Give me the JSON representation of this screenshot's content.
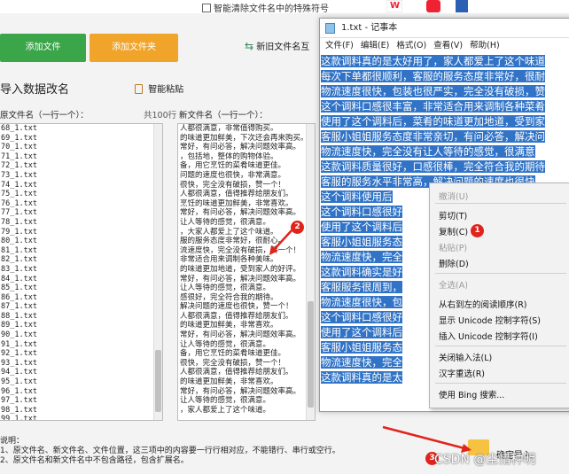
{
  "topbar": {
    "special_chars": "智能清除文件名中的特殊符号"
  },
  "toolbar": {
    "add_file": "添加文件",
    "add_folder": "添加文件夹",
    "new_old_label": "新旧文件名互"
  },
  "section": {
    "title": "导入数据改名",
    "paste_label": "智能粘贴"
  },
  "columns": {
    "original_header": "原文件名（一行一个）：",
    "count": "共100行",
    "new_header": "新文件名（一行一个）："
  },
  "original_files": [
    "68_1.txt",
    "69_1.txt",
    "70_1.txt",
    "71_1.txt",
    "72_1.txt",
    "73_1.txt",
    "74_1.txt",
    "75_1.txt",
    "76_1.txt",
    "77_1.txt",
    "78_1.txt",
    "79_1.txt",
    "80_1.txt",
    "81_1.txt",
    "82_1.txt",
    "83_1.txt",
    "84_1.txt",
    "85_1.txt",
    "86_1.txt",
    "87_1.txt",
    "88_1.txt",
    "89_1.txt",
    "90_1.txt",
    "91_1.txt",
    "92_1.txt",
    "93_1.txt",
    "94_1.txt",
    "95_1.txt",
    "96_1.txt",
    "97_1.txt",
    "98_1.txt",
    "99_1.txt"
  ],
  "new_files": [
    "人都很满意，非常值得购买。",
    "的味道更加鲜美，下次还会再来购买。",
    "常好，有问必答，解决问题效率高。",
    "，包括地，整体的购物体验。",
    "备，用它烹饪的菜肴味道更佳。",
    "问题的速度也很快，非常满意。",
    "很快，完全没有破损，赞一个！",
    "人都很满意，值得推荐给朋友们。",
    "烹饪的味道更加鲜美，非常喜欢。",
    "常好，有问必答，解决问题效率高。",
    "让人等待的感觉，很满意。",
    "，大家人都爱上了这个味道。",
    "服的服务态度非常好，很耐心。",
    "流速度快，完全没有破损，赞一个！",
    "非常适合用来调制各种美味。",
    "的味道更加地道，受到家人的好评。",
    "常好，有问必答，解决问题效率高。",
    "让人等待的感觉，很满意。",
    "感很好，完全符合我的期待。",
    "解决问题的速度也很快，赞一个！",
    "人都很满意，值得推荐给朋友们。",
    "的味道更加鲜美，非常喜欢。",
    "常好，有问必答，解决问题效率高。",
    "让人等待的感觉，很满意。",
    "备，用它烹饪的菜肴味道更佳。",
    "很快，完全没有破损，赞一个！",
    "人都很满意，值得推荐给朋友们。",
    "的味道更加鲜美，非常喜欢。",
    "常好，有问必答，解决问题效率高。",
    "让人等待的感觉，很满意。",
    "，家人都爱上了这个味道。"
  ],
  "notepad": {
    "title": "1.txt - 记事本",
    "menus": [
      "文件(F)",
      "编辑(E)",
      "格式(O)",
      "查看(V)",
      "帮助(H)"
    ],
    "lines": [
      "这款调料真的是太好用了，家人都爱上了这个味道",
      "每次下单都很顺利，客服的服务态度非常好，很耐",
      "物流速度很快，包装也很严实，完全没有破损，赞",
      "这个调料口感很丰富，非常适合用来调制各种菜肴",
      "使用了这个调料后，菜肴的味道更加地道，受到家",
      "客服小姐姐服务态度非常亲切，有问必答，解决问",
      "物流速度快，完全没有让人等待的感觉，很满意",
      "这款调料质量很好，口感很棒，完全符合我的期待",
      "客服的服务水平非常高，解决问题的速度也很快",
      "这个调料使用后",
      "这个调料口感很好",
      "使用了这个调料后",
      "客服小姐姐服务态",
      "物流速度快，完全",
      "这款调料确实是好",
      "客服服务很周到，",
      "物流速度很快，包",
      "这个调料口感很好",
      "使用了这个调料后",
      "客服小姐姐服务态",
      "物流速度快，完全",
      "这款调料真的是太"
    ]
  },
  "context_menu": {
    "items": [
      {
        "label": "撤消(U)",
        "enabled": false
      },
      {
        "label": "剪切(T)",
        "enabled": true
      },
      {
        "label": "复制(C)",
        "enabled": true
      },
      {
        "label": "粘贴(P)",
        "enabled": false
      },
      {
        "label": "删除(D)",
        "enabled": true
      },
      {
        "label": "全选(A)",
        "enabled": false
      },
      {
        "label": "从右到左的阅读顺序(R)",
        "enabled": true
      },
      {
        "label": "显示 Unicode 控制字符(S)",
        "enabled": true
      },
      {
        "label": "插入 Unicode 控制字符(I)",
        "enabled": true
      },
      {
        "label": "关闭输入法(L)",
        "enabled": true
      },
      {
        "label": "汉字重选(R)",
        "enabled": true
      },
      {
        "label": "使用 Bing 搜索...",
        "enabled": true
      }
    ]
  },
  "badges": {
    "b1": "1",
    "b2": "2",
    "b3": "3"
  },
  "bottom": {
    "note_line1": "说明：",
    "note_line2": "1、原文件名、新文件名、文件位置，这三项中的内容要一行行相对应，不能错行、串行或空行。",
    "note_line3": "2、原文件名和新文件名中不包含路径，包含扩展名。",
    "confirm_button": "确定导入",
    "watermark": "CSDN @尘惜种明"
  },
  "colors": {
    "green": "#3aa649",
    "orange": "#f0a52a",
    "selection": "#3174c7",
    "badge": "#e0241b"
  }
}
